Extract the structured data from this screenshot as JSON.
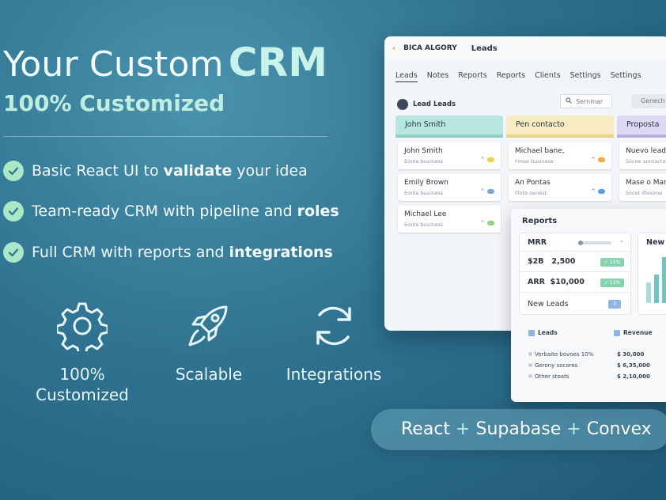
{
  "hero": {
    "title_prefix": "Your Custom",
    "title_highlight": "CRM",
    "subtitle": "100% Customized"
  },
  "features": [
    {
      "pre": "Basic React UI to ",
      "bold": "validate",
      "post": " your idea"
    },
    {
      "pre": "Team-ready CRM with pipeline and ",
      "bold": "roles",
      "post": ""
    },
    {
      "pre": "Full CRM with reports and ",
      "bold": "integrations",
      "post": ""
    }
  ],
  "icons": [
    {
      "name": "gear-icon",
      "label_line1": "100%",
      "label_line2": "Customized"
    },
    {
      "name": "rocket-icon",
      "label_line1": "Scalable",
      "label_line2": ""
    },
    {
      "name": "sync-icon",
      "label_line1": "Integrations",
      "label_line2": ""
    }
  ],
  "app": {
    "brand": "BICA ALGORY",
    "section": "Leads",
    "tabs": [
      "Leads",
      "Notes",
      "Reports",
      "Reports",
      "Clients",
      "Settings",
      "Settings"
    ],
    "toolbar_label": "Lead Leads",
    "search_placeholder": "Sernmar",
    "gen_button": "Genech",
    "columns": [
      {
        "title": "John Smith",
        "cards": [
          {
            "name": "John Smith",
            "sub": "Eoote business"
          },
          {
            "name": "Emily Brown",
            "sub": "Eoote business"
          },
          {
            "name": "Michael Lee",
            "sub": "Eoote business"
          }
        ]
      },
      {
        "title": "Pen contacto",
        "cards": [
          {
            "name": "Michael bane,",
            "sub": "Fmoe business"
          },
          {
            "name": "An Pontas",
            "sub": "Flote oenest"
          }
        ]
      },
      {
        "title": "Proposta",
        "cards": [
          {
            "name": "Nuevo lead",
            "sub": "Socoe aontacto"
          },
          {
            "name": "Mase o Mari",
            "sub": "Socet ilhoome"
          }
        ]
      }
    ]
  },
  "reports": {
    "title": "Reports",
    "mrr_label": "MRR",
    "row1_a": "$2B",
    "row1_b": "2,500",
    "row1_pill": "✓ 11%",
    "row2_a": "ARR",
    "row2_b": "$10,000",
    "row2_pill": "✓ 11%",
    "row3": "New Leads",
    "row3_badge": "3",
    "new_label": "New",
    "table": {
      "col1": "Leads",
      "col2": "Revenue",
      "rows": [
        {
          "name": "Verbaite bovoes 10%",
          "value": "$ 30,000"
        },
        {
          "name": "Gerony socores",
          "value": "$ 6,35,000"
        },
        {
          "name": "Other stoats",
          "value": "$ 2,10,000"
        }
      ]
    }
  },
  "stack": {
    "part1": "React",
    "sep1": "+",
    "part2": "Supabase",
    "sep2": "+",
    "part3": "Convex"
  },
  "colors": {
    "accent_check": "#a8e8c7",
    "title_highlight": "#c9f2ea"
  }
}
